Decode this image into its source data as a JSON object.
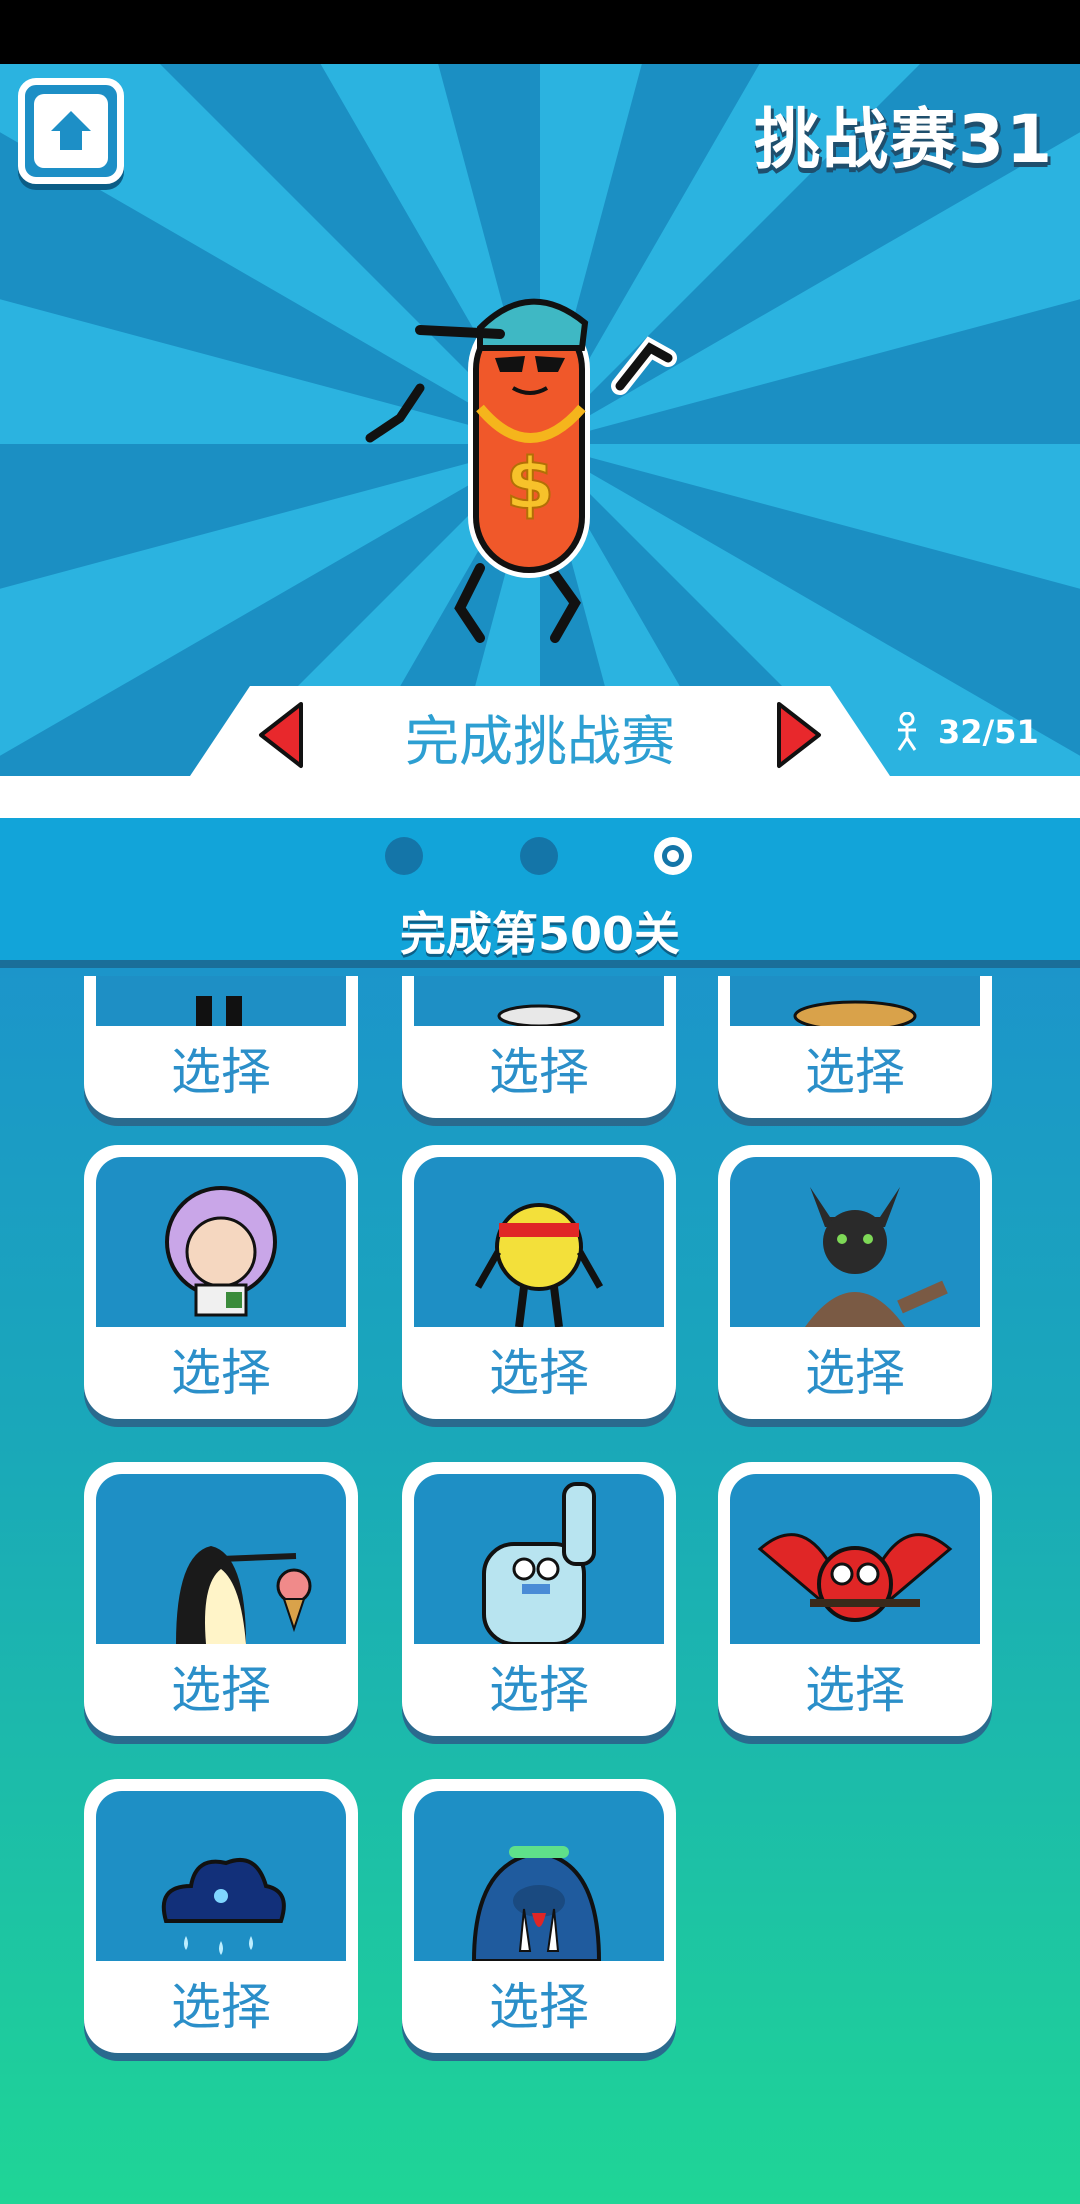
{
  "header": {
    "challenge_title": "挑战赛31",
    "home_button": "home-icon"
  },
  "banner": {
    "text": "完成挑战赛",
    "progress": "32/51"
  },
  "level_panel": {
    "page_index": 3,
    "page_count": 3,
    "text": "完成第500关"
  },
  "cards": [
    {
      "label": "选择",
      "character": "partial-character-1"
    },
    {
      "label": "选择",
      "character": "partial-character-2"
    },
    {
      "label": "选择",
      "character": "partial-character-3"
    },
    {
      "label": "选择",
      "character": "grandma-icon"
    },
    {
      "label": "选择",
      "character": "tennis-ball-icon"
    },
    {
      "label": "选择",
      "character": "black-cat-icon"
    },
    {
      "label": "选择",
      "character": "penguin-icon"
    },
    {
      "label": "选择",
      "character": "yeti-icon"
    },
    {
      "label": "选择",
      "character": "owl-icon"
    },
    {
      "label": "选择",
      "character": "rain-cloud-icon"
    },
    {
      "label": "选择",
      "character": "walrus-icon"
    }
  ],
  "colors": {
    "ray_light": "#2bb3e0",
    "ray_dark": "#1b8fc3",
    "label_blue": "#2b8fc9",
    "arrow_red": "#e8282c"
  }
}
